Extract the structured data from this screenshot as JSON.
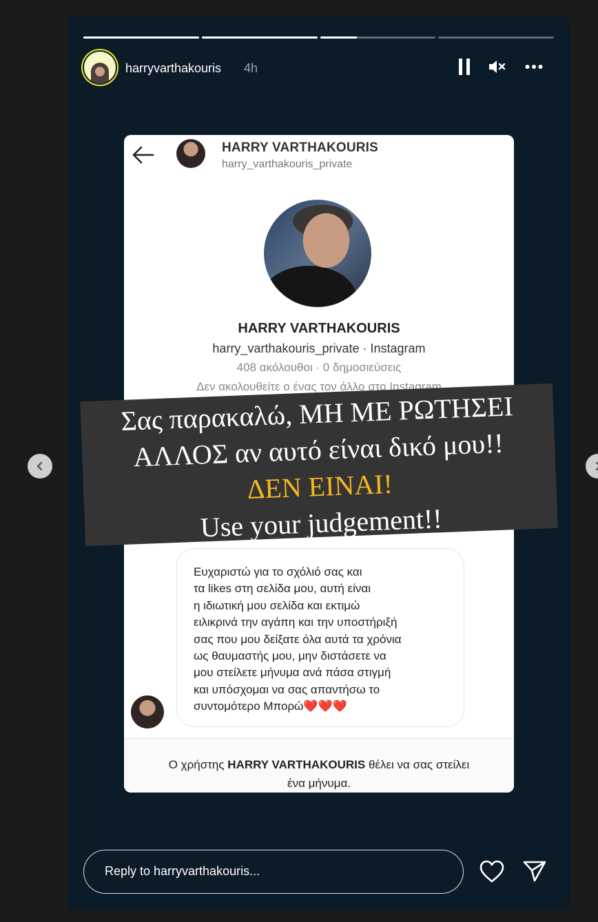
{
  "story": {
    "username": "harryvarthakouris",
    "time": "4h",
    "progress": [
      1,
      1,
      0.32,
      0
    ],
    "icons": {
      "pause": "pause-icon",
      "mute": "speaker-muted-icon",
      "more": "more-dots-icon"
    }
  },
  "screenshot": {
    "header_name": "HARRY VARTHAKOURIS",
    "header_user": "harry_varthakouris_private",
    "profile_name": "HARRY VARTHAKOURIS",
    "profile_user": "harry_varthakouris_private · Instagram",
    "profile_stats": "408 ακόλουθοι · 0 δημοσιεύσεις",
    "profile_follow": "Δεν ακολουθείτε ο ένας τον άλλο στο Instagram",
    "message_lines": [
      "Ευχαριστώ για το σχόλιό σας και",
      "τα likes στη σελίδα μου, αυτή είναι",
      "η ιδιωτική μου σελίδα και εκτιμώ",
      "ειλικρινά την αγάπη και την υποστήριξή",
      "σας που μου δείξατε όλα αυτά τα χρόνια",
      "ως θαυμαστής μου, μην διστάσετε να",
      "μου στείλετε μήνυμα ανά πάσα στιγμή",
      "και υπόσχομαι να σας απαντήσω το",
      "συντομότερο  Μπορώ❤️❤️❤️"
    ],
    "footer_prefix": "Ο χρήστης ",
    "footer_name": "HARRY VARTHAKOURIS",
    "footer_suffix": " θέλει να σας στείλει",
    "footer_line2": "ένα μήνυμα."
  },
  "banner": {
    "line1": "Σας παρακαλώ, ΜΗ ΜΕ ΡΩΤΗΣΕΙ",
    "line2": "ΑΛΛΟΣ αν αυτό είναι δικό μου!!",
    "line3": "ΔΕΝ ΕΙΝΑΙ!",
    "line4": "Use your judgement!!",
    "highlight_color": "#f5b820"
  },
  "reply": {
    "placeholder": "Reply to harryvarthakouris...",
    "icons": {
      "like": "heart-icon",
      "send": "send-icon"
    }
  },
  "nav": {
    "prev": "chevron-left-icon",
    "next": "chevron-right-icon"
  }
}
